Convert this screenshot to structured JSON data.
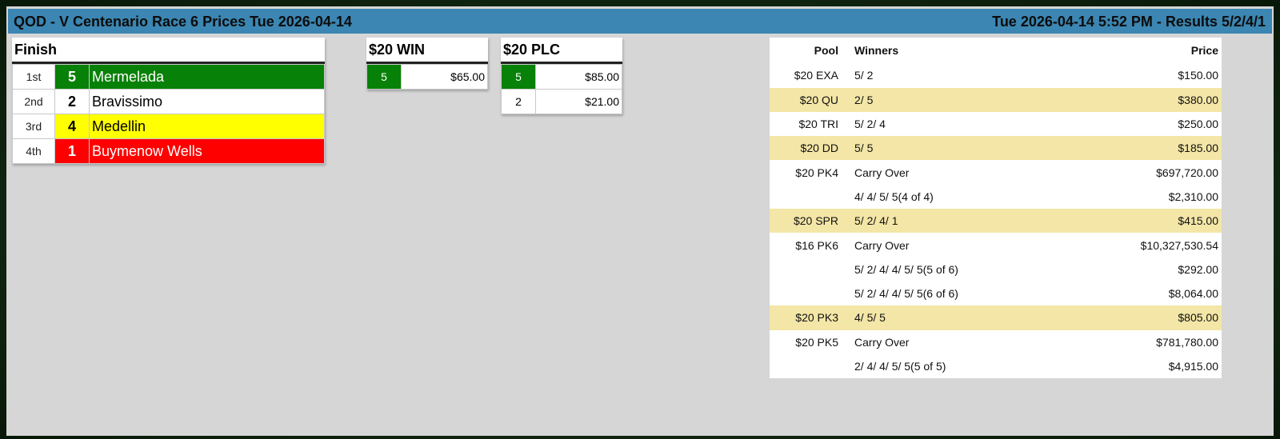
{
  "header": {
    "title": "QOD - V Centenario Race 6 Prices Tue 2026-04-14",
    "status": "Tue 2026-04-14 5:52 PM - Results 5/2/4/1"
  },
  "finish": {
    "label": "Finish",
    "rows": [
      {
        "pos": "1st",
        "num": "5",
        "name": "Mermelada",
        "bg": "#078107",
        "fg": "#ffffff"
      },
      {
        "pos": "2nd",
        "num": "2",
        "name": "Bravissimo",
        "bg": "#ffffff",
        "fg": "#000000"
      },
      {
        "pos": "3rd",
        "num": "4",
        "name": "Medellin",
        "bg": "#ffff00",
        "fg": "#000000"
      },
      {
        "pos": "4th",
        "num": "1",
        "name": "Buymenow Wells",
        "bg": "#ff0000",
        "fg": "#ffffff"
      }
    ]
  },
  "win": {
    "label": "$20 WIN",
    "rows": [
      {
        "num": "5",
        "amount": "$65.00",
        "highlight": true
      }
    ]
  },
  "plc": {
    "label": "$20 PLC",
    "rows": [
      {
        "num": "5",
        "amount": "$85.00",
        "highlight": true
      },
      {
        "num": "2",
        "amount": "$21.00",
        "highlight": false
      }
    ]
  },
  "exotics": {
    "headers": {
      "pool": "Pool",
      "winners": "Winners",
      "price": "Price"
    },
    "rows": [
      {
        "pool": "$20 EXA",
        "winners": "5/ 2",
        "price": "$150.00",
        "hl": false
      },
      {
        "pool": "$20 QU",
        "winners": "2/ 5",
        "price": "$380.00",
        "hl": true
      },
      {
        "pool": "$20 TRI",
        "winners": "5/ 2/ 4",
        "price": "$250.00",
        "hl": false
      },
      {
        "pool": "$20 DD",
        "winners": "5/ 5",
        "price": "$185.00",
        "hl": true
      },
      {
        "pool": "$20 PK4",
        "winners": "Carry Over",
        "price": "$697,720.00",
        "hl": false
      },
      {
        "pool": "",
        "winners": "4/ 4/ 5/ 5(4 of 4)",
        "price": "$2,310.00",
        "hl": false
      },
      {
        "pool": "$20 SPR",
        "winners": "5/ 2/ 4/ 1",
        "price": "$415.00",
        "hl": true
      },
      {
        "pool": "$16 PK6",
        "winners": "Carry Over",
        "price": "$10,327,530.54",
        "hl": false
      },
      {
        "pool": "",
        "winners": "5/ 2/ 4/ 4/ 5/ 5(5 of 6)",
        "price": "$292.00",
        "hl": false
      },
      {
        "pool": "",
        "winners": "5/ 2/ 4/ 4/ 5/ 5(6 of 6)",
        "price": "$8,064.00",
        "hl": false
      },
      {
        "pool": "$20 PK3",
        "winners": "4/ 5/ 5",
        "price": "$805.00",
        "hl": true
      },
      {
        "pool": "$20 PK5",
        "winners": "Carry Over",
        "price": "$781,780.00",
        "hl": false
      },
      {
        "pool": "",
        "winners": "2/ 4/ 4/ 5/ 5(5 of 5)",
        "price": "$4,915.00",
        "hl": false
      }
    ]
  }
}
